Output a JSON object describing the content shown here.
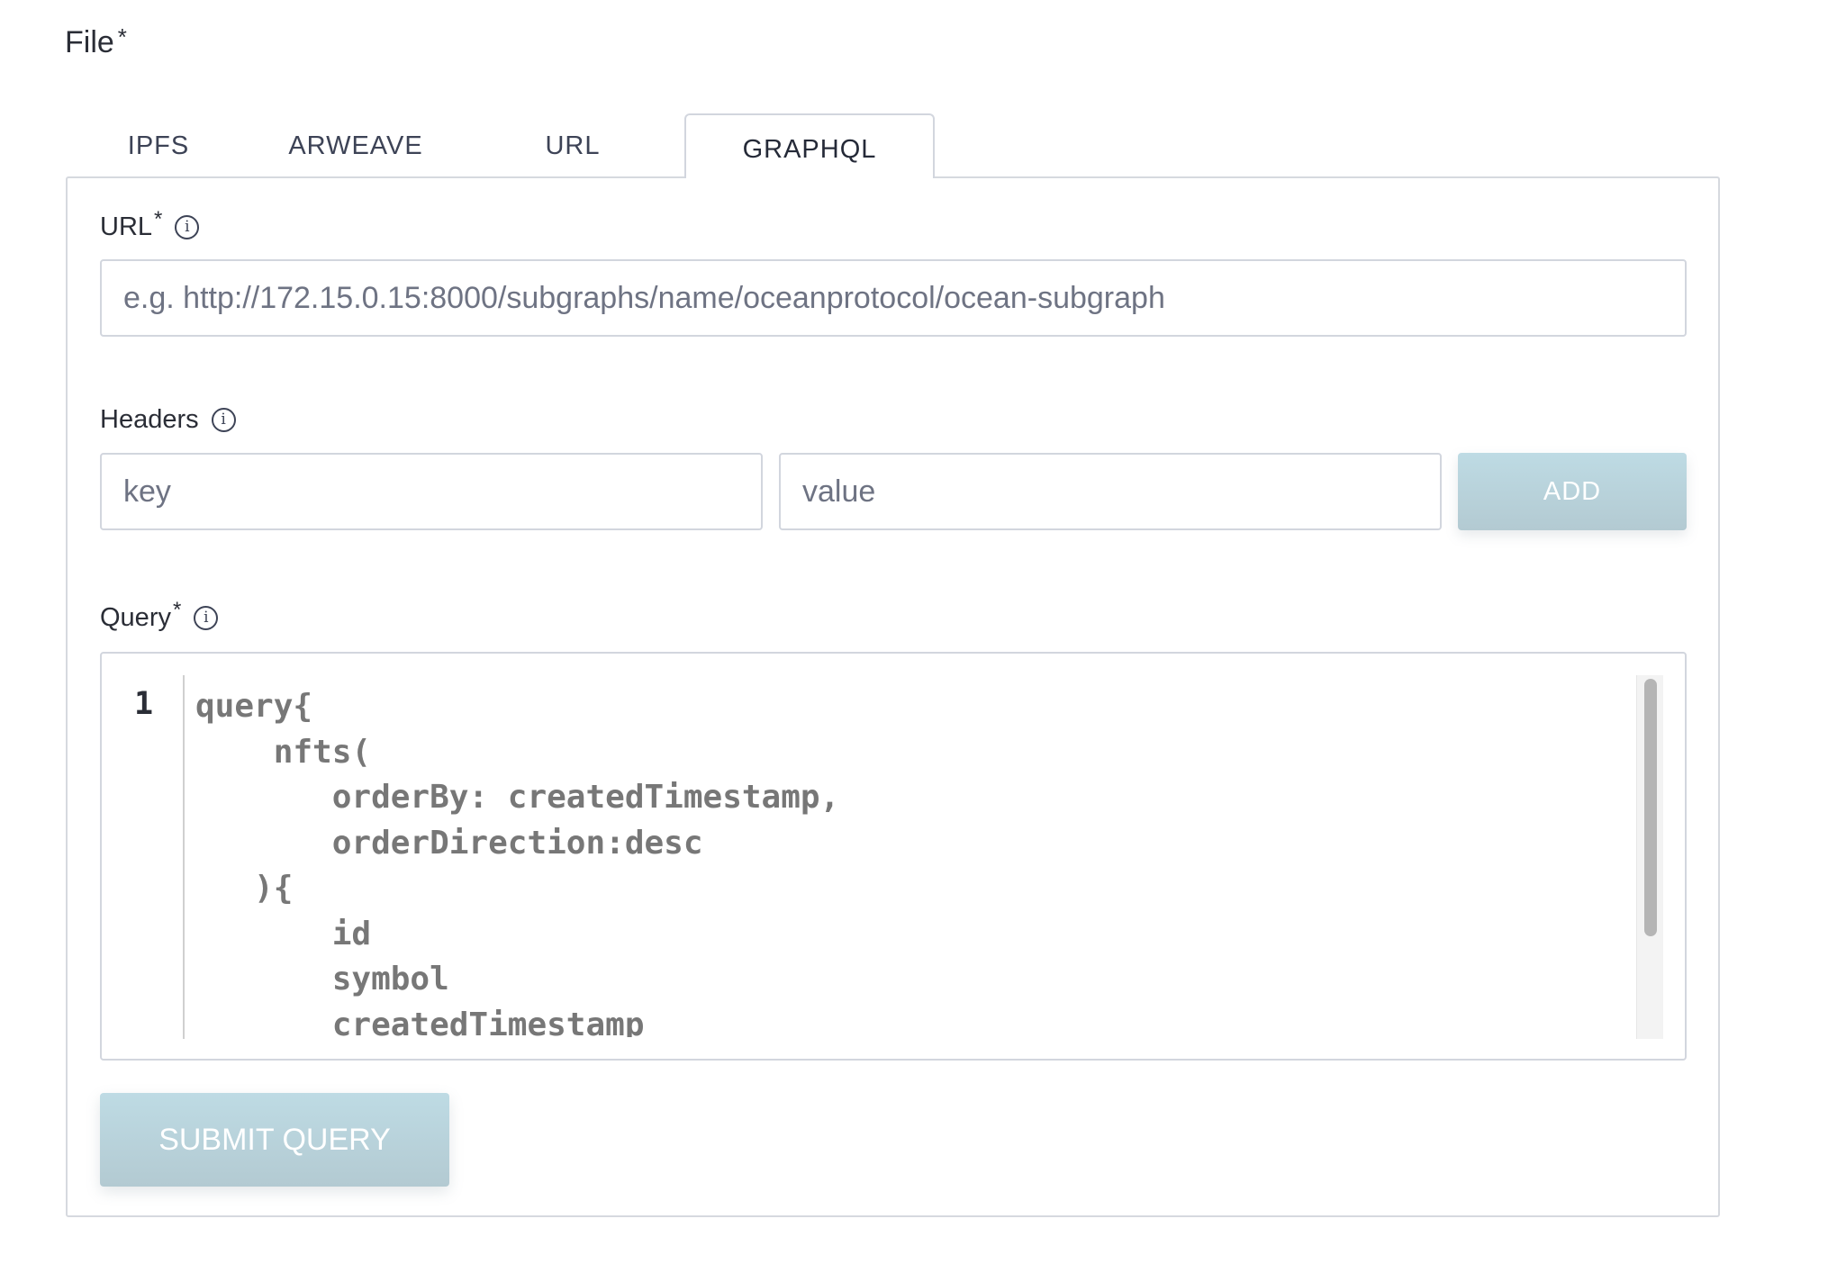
{
  "file": {
    "label": "File",
    "required_mark": "*"
  },
  "tabs": [
    {
      "label": "IPFS",
      "active": false
    },
    {
      "label": "ARWEAVE",
      "active": false
    },
    {
      "label": "URL",
      "active": false
    },
    {
      "label": "GRAPHQL",
      "active": true
    }
  ],
  "url_field": {
    "label": "URL",
    "required_mark": "*",
    "info_icon": "info-icon",
    "value": "",
    "placeholder": "e.g. http://172.15.0.15:8000/subgraphs/name/oceanprotocol/ocean-subgraph"
  },
  "headers": {
    "label": "Headers",
    "info_icon": "info-icon",
    "key_placeholder": "key",
    "value_placeholder": "value",
    "add_label": "ADD"
  },
  "query": {
    "label": "Query",
    "required_mark": "*",
    "info_icon": "info-icon",
    "line_number": "1",
    "code": "query{\n    nfts(\n       orderBy: createdTimestamp,\n       orderDirection:desc\n   ){\n       id\n       symbol\n       createdTimestamp"
  },
  "submit": {
    "label": "SUBMIT QUERY"
  },
  "colors": {
    "button_bg": "#bedbe4",
    "border": "#d2d6de",
    "text": "#2a2d36",
    "code_text": "#777777"
  }
}
